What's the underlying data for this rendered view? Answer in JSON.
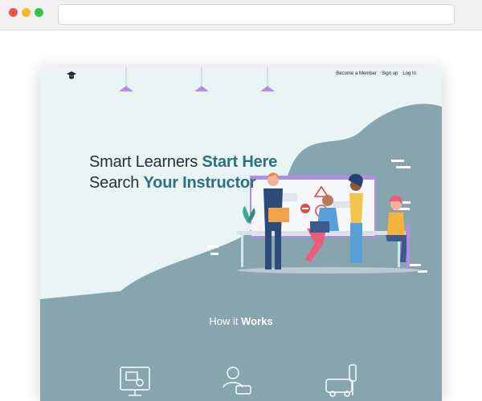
{
  "browser": {
    "url": ""
  },
  "site": {
    "nav": [
      {
        "label": "Become a Member"
      },
      {
        "label": "Sign up"
      },
      {
        "label": "Log In"
      }
    ],
    "hero": {
      "line1_plain": "Smart Learners ",
      "line1_accent": "Start Here",
      "line2_plain": "Search ",
      "line2_accent": "Your Instructor"
    },
    "how_it_works": {
      "plain": "How it ",
      "accent": "Works"
    },
    "icons": [
      "graduation-cap-icon",
      "monitor-certificate-icon",
      "instructor-car-icon",
      "traffic-light-car-icon"
    ]
  },
  "colors": {
    "bg_mint": "#e9f5f4",
    "slate": "#87a5af",
    "accent_teal": "#2e6f81",
    "heading_dark": "#2a2f36",
    "lamp_purple": "#b28ce6"
  }
}
